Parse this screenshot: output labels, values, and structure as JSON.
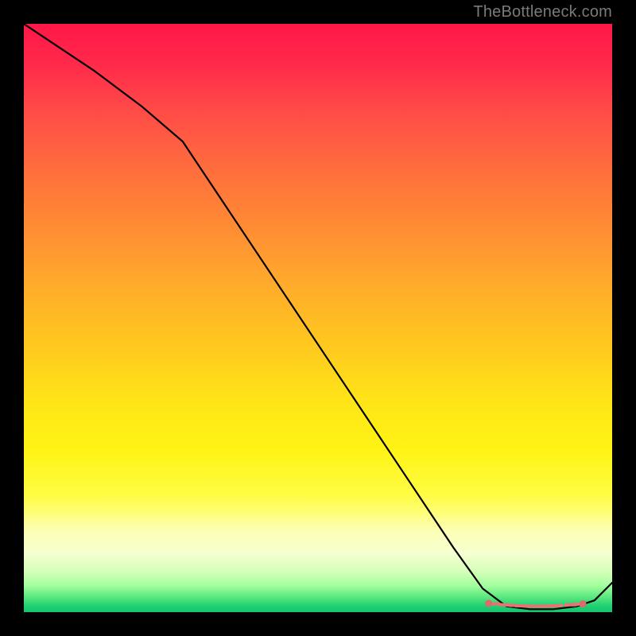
{
  "watermark": "TheBottleneck.com",
  "chart_data": {
    "type": "line",
    "title": "",
    "xlabel": "",
    "ylabel": "",
    "xlim": [
      0,
      100
    ],
    "ylim": [
      0,
      100
    ],
    "grid": false,
    "legend": "none",
    "series": [
      {
        "name": "bottleneck-curve",
        "comment": "curve from top-left descending to a flat trough near x≈80-95 then rising; x is horizontal fraction, y is percentage (0 bottom, 100 top)",
        "x": [
          0,
          12,
          20,
          27,
          35,
          45,
          55,
          65,
          73,
          78,
          82,
          86,
          90,
          94,
          97,
          100
        ],
        "y": [
          100,
          92,
          86,
          80,
          68,
          53,
          38,
          23,
          11,
          4,
          1,
          0.5,
          0.5,
          1,
          2,
          5
        ]
      },
      {
        "name": "trough-marker",
        "comment": "short salmon-colored tick marks along the flat trough (~y≈1)",
        "x": [
          79,
          81,
          82.5,
          83.5,
          85,
          86.5,
          88,
          89.5,
          91,
          95
        ],
        "y": [
          1.5,
          1.3,
          1.2,
          1.1,
          1.05,
          1.0,
          1.0,
          1.05,
          1.1,
          1.4
        ]
      }
    ],
    "annotations": [
      {
        "text": "TheBottleneck.com",
        "pos": "top-right",
        "role": "watermark"
      }
    ]
  }
}
